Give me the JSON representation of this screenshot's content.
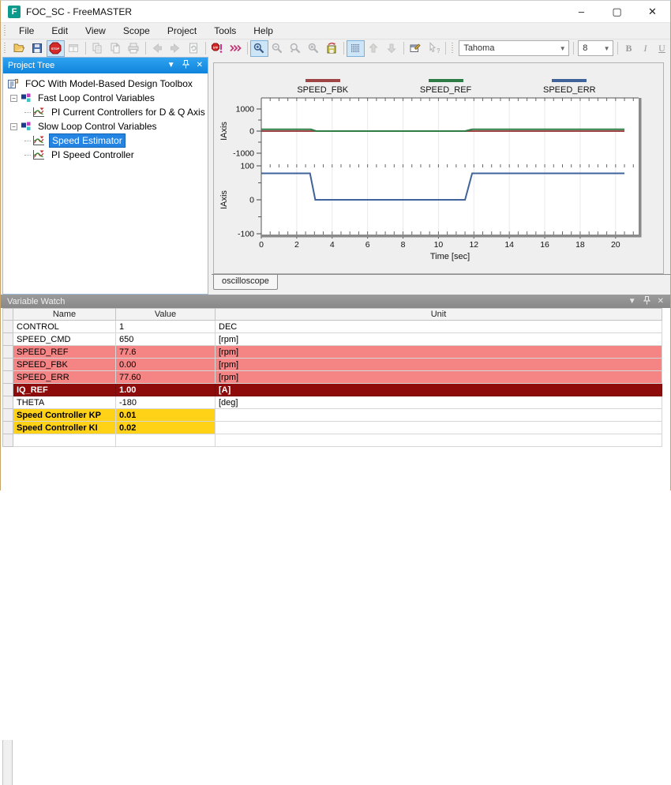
{
  "window": {
    "title": "FOC_SC - FreeMASTER",
    "app_initial": "F",
    "controls": {
      "minimize": "–",
      "maximize": "▢",
      "close": "✕"
    }
  },
  "menu": {
    "items": [
      "File",
      "Edit",
      "View",
      "Scope",
      "Project",
      "Tools",
      "Help"
    ]
  },
  "toolbar": {
    "font_name": "Tahoma",
    "font_size": "8",
    "buttons": [
      {
        "name": "open-project",
        "icon": "open",
        "state": "normal"
      },
      {
        "name": "save-project",
        "icon": "save",
        "state": "normal"
      },
      {
        "name": "stop-communication",
        "icon": "stop",
        "state": "selected"
      },
      {
        "name": "project-window",
        "icon": "window",
        "state": "disabled"
      },
      {
        "sep": true
      },
      {
        "name": "copy",
        "icon": "copy",
        "state": "disabled"
      },
      {
        "name": "copy-special",
        "icon": "copy2",
        "state": "disabled"
      },
      {
        "name": "print",
        "icon": "print",
        "state": "disabled"
      },
      {
        "sep": true
      },
      {
        "name": "go-back",
        "icon": "arrow-left",
        "state": "disabled"
      },
      {
        "name": "go-forward",
        "icon": "arrow-right",
        "state": "disabled"
      },
      {
        "name": "reload-page",
        "icon": "reload",
        "state": "disabled"
      },
      {
        "sep": true
      },
      {
        "name": "stop-on-error",
        "icon": "stp-alert",
        "state": "normal"
      },
      {
        "name": "fast-communication",
        "icon": "chevrons",
        "state": "normal"
      },
      {
        "sep": true
      },
      {
        "name": "scope-zoom-default",
        "icon": "zoom",
        "state": "selected"
      },
      {
        "name": "scope-zoom-out",
        "icon": "zoom-out",
        "state": "disabled"
      },
      {
        "name": "scope-zoom-undo",
        "icon": "zoom-undo",
        "state": "disabled"
      },
      {
        "name": "scope-zoom-free",
        "icon": "zoom-free",
        "state": "disabled"
      },
      {
        "name": "save-scope-data",
        "icon": "save-scope",
        "state": "normal"
      },
      {
        "sep": true
      },
      {
        "name": "toggle-grid",
        "icon": "grid",
        "state": "selected"
      },
      {
        "name": "move-up",
        "icon": "arrow-up",
        "state": "disabled"
      },
      {
        "name": "move-down",
        "icon": "arrow-down",
        "state": "disabled"
      },
      {
        "sep": true
      },
      {
        "name": "properties",
        "icon": "properties",
        "state": "normal"
      },
      {
        "name": "context-help",
        "icon": "help-arrow",
        "state": "disabled"
      },
      {
        "sep": true
      }
    ],
    "format_buttons": [
      "B",
      "I",
      "U"
    ]
  },
  "project_tree": {
    "title": "Project Tree",
    "items": [
      {
        "label": "FOC With Model-Based Design Toolbox",
        "level": 0,
        "icon": "project",
        "expander": false,
        "selected": false
      },
      {
        "label": "Fast Loop Control Variables",
        "level": 1,
        "icon": "blocks",
        "expander": true,
        "selected": false
      },
      {
        "label": "PI Current Controllers for D & Q Axis",
        "level": 2,
        "icon": "scope",
        "expander": false,
        "selected": false
      },
      {
        "label": "Slow Loop Control Variables",
        "level": 1,
        "icon": "blocks",
        "expander": true,
        "selected": false
      },
      {
        "label": "Speed Estimator",
        "level": 2,
        "icon": "scope",
        "expander": false,
        "selected": true
      },
      {
        "label": "PI Speed Controller",
        "level": 2,
        "icon": "scope",
        "expander": false,
        "selected": false
      }
    ]
  },
  "scope": {
    "tab_label": "oscilloscope",
    "chart_data": {
      "type": "line",
      "xlabel": "Time [sec]",
      "xlim": [
        0,
        21.3
      ],
      "x_ticks": [
        0,
        2,
        4,
        6,
        8,
        10,
        12,
        14,
        16,
        18,
        20
      ],
      "x_minor_step": 0.5,
      "grid": "vertical-major",
      "legend_position": "top",
      "legend": [
        {
          "label": "SPEED_FBK",
          "color": "#a04545"
        },
        {
          "label": "SPEED_REF",
          "color": "#2e7d46"
        },
        {
          "label": "SPEED_ERR",
          "color": "#41639b"
        }
      ],
      "subplots": [
        {
          "ylabel": "IAxis",
          "ylim": [
            -1000,
            1000
          ],
          "y_ticks": [
            1000,
            0,
            -1000
          ],
          "series": [
            {
              "name": "SPEED_FBK",
              "color": "#a04545",
              "points": [
                [
                  0,
                  0
                ],
                [
                  20.5,
                  0
                ]
              ]
            },
            {
              "name": "SPEED_REF",
              "color": "#2e7d46",
              "points": [
                [
                  0,
                  77.6
                ],
                [
                  2.8,
                  77.6
                ],
                [
                  3.1,
                  0
                ],
                [
                  11.5,
                  0
                ],
                [
                  11.9,
                  77.6
                ],
                [
                  20.5,
                  77.6
                ]
              ]
            }
          ]
        },
        {
          "ylabel": "IAxis",
          "ylim": [
            -100,
            100
          ],
          "y_ticks": [
            100,
            0,
            -100
          ],
          "series": [
            {
              "name": "SPEED_ERR",
              "color": "#41639b",
              "points": [
                [
                  0,
                  78
                ],
                [
                  2.75,
                  78
                ],
                [
                  3.05,
                  0
                ],
                [
                  11.5,
                  0
                ],
                [
                  11.9,
                  78
                ],
                [
                  20.5,
                  78
                ]
              ]
            }
          ]
        }
      ]
    }
  },
  "watch": {
    "title": "Variable Watch",
    "columns": [
      "Name",
      "Value",
      "Unit"
    ],
    "rows": [
      {
        "name": "CONTROL",
        "value": "1",
        "unit": "DEC",
        "style": "normal"
      },
      {
        "name": "SPEED_CMD",
        "value": "650",
        "unit": "[rpm]",
        "style": "normal"
      },
      {
        "name": "SPEED_REF",
        "value": "77.6",
        "unit": "[rpm]",
        "style": "alarm"
      },
      {
        "name": "SPEED_FBK",
        "value": "0.00",
        "unit": "[rpm]",
        "style": "alarm"
      },
      {
        "name": "SPEED_ERR",
        "value": "77.60",
        "unit": "[rpm]",
        "style": "alarm"
      },
      {
        "name": "IQ_REF",
        "value": "1.00",
        "unit": "[A]",
        "style": "selected"
      },
      {
        "name": "THETA",
        "value": "-180",
        "unit": "[deg]",
        "style": "normal"
      },
      {
        "name": "Speed Controller KP",
        "value": "0.01",
        "unit": "",
        "style": "gain"
      },
      {
        "name": "Speed Controller KI",
        "value": "0.02",
        "unit": "",
        "style": "gain"
      },
      {
        "name": "",
        "value": "",
        "unit": "",
        "style": "empty"
      }
    ]
  },
  "colors": {
    "accent_header_blue": "#1b93e8",
    "tree_selection_bg": "#2384e3",
    "alarm_row_bg": "#f58585",
    "selected_row_bg": "#8e0b0b",
    "selected_row_fg": "#ffffff",
    "gain_row_bg": "#ffd117",
    "stop_icon_red": "#d42a2a",
    "series_red": "#a04545",
    "series_green": "#2e7d46",
    "series_blue": "#41639b"
  }
}
